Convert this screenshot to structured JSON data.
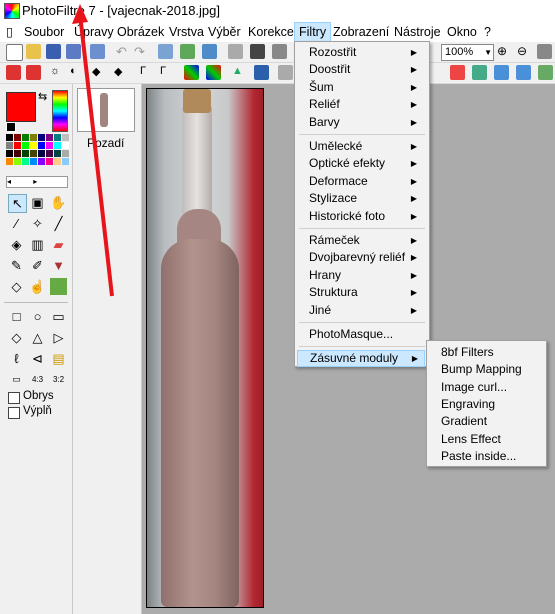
{
  "window": {
    "title": "PhotoFiltre 7 - [vajecnak-2018.jpg]"
  },
  "menu": [
    "Soubor",
    "Úpravy",
    "Obrázek",
    "Vrstva",
    "Výběr",
    "Korekce",
    "Filtry",
    "Zobrazení",
    "Nástroje",
    "Okno",
    "?"
  ],
  "toolbar": {
    "zoom": "100%"
  },
  "layers": {
    "background_label": "Pozadí"
  },
  "tools": {
    "outline_label": "Obrys",
    "fill_label": "Výplň"
  },
  "filters_menu": {
    "items": [
      {
        "label": "Rozostřit",
        "submenu": true
      },
      {
        "label": "Doostřit",
        "submenu": true
      },
      {
        "label": "Šum",
        "submenu": true
      },
      {
        "label": "Reliéf",
        "submenu": true
      },
      {
        "label": "Barvy",
        "submenu": true
      },
      {
        "label": "Umělecké",
        "submenu": true
      },
      {
        "label": "Optické efekty",
        "submenu": true
      },
      {
        "label": "Deformace",
        "submenu": true
      },
      {
        "label": "Stylizace",
        "submenu": true
      },
      {
        "label": "Historické foto",
        "submenu": true
      },
      {
        "label": "Rámeček",
        "submenu": true
      },
      {
        "label": "Dvojbarevný reliéf",
        "submenu": true
      },
      {
        "label": "Hrany",
        "submenu": true
      },
      {
        "label": "Struktura",
        "submenu": true
      },
      {
        "label": "Jiné",
        "submenu": true
      },
      {
        "label": "PhotoMasque...",
        "submenu": false
      },
      {
        "label": "Zásuvné moduly",
        "submenu": true
      }
    ]
  },
  "plugins_submenu": {
    "items": [
      "8bf Filters",
      "Bump Mapping",
      "Image curl...",
      "Engraving",
      "Gradient",
      "Lens Effect",
      "Paste inside..."
    ]
  },
  "colors": {
    "foreground": "#ff0000",
    "background": "#ffffff",
    "menu_highlight": "#cce8ff",
    "arrow": "#e8141c"
  }
}
